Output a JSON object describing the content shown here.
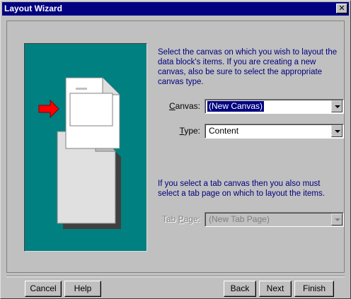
{
  "window": {
    "title": "Layout Wizard",
    "close_glyph": "✕"
  },
  "description": {
    "canvas_instructions": "Select the canvas on which you wish to layout the data block's items. If you are creating a new canvas, also be sure to select the appropriate canvas type.",
    "tab_instructions": "If you select a tab canvas then you also must select a tab page on which to layout the items."
  },
  "fields": {
    "canvas": {
      "label_mnemonic": "C",
      "label_rest": "anvas:",
      "value": "(New Canvas)"
    },
    "type": {
      "label_mnemonic": "T",
      "label_rest": "ype:",
      "value": "Content"
    },
    "tab_page": {
      "label_first": "Tab ",
      "label_mnemonic": "P",
      "label_rest": "age:",
      "value": "(New Tab Page)",
      "enabled": false
    }
  },
  "buttons": {
    "cancel": "Cancel",
    "help": "Help",
    "back": "Back",
    "next": "Next",
    "finish": "Finish"
  },
  "colors": {
    "title_bar": "#000080",
    "illustration_bg": "#008080",
    "instruction_text": "#000080",
    "arrow": "#ff0000"
  }
}
